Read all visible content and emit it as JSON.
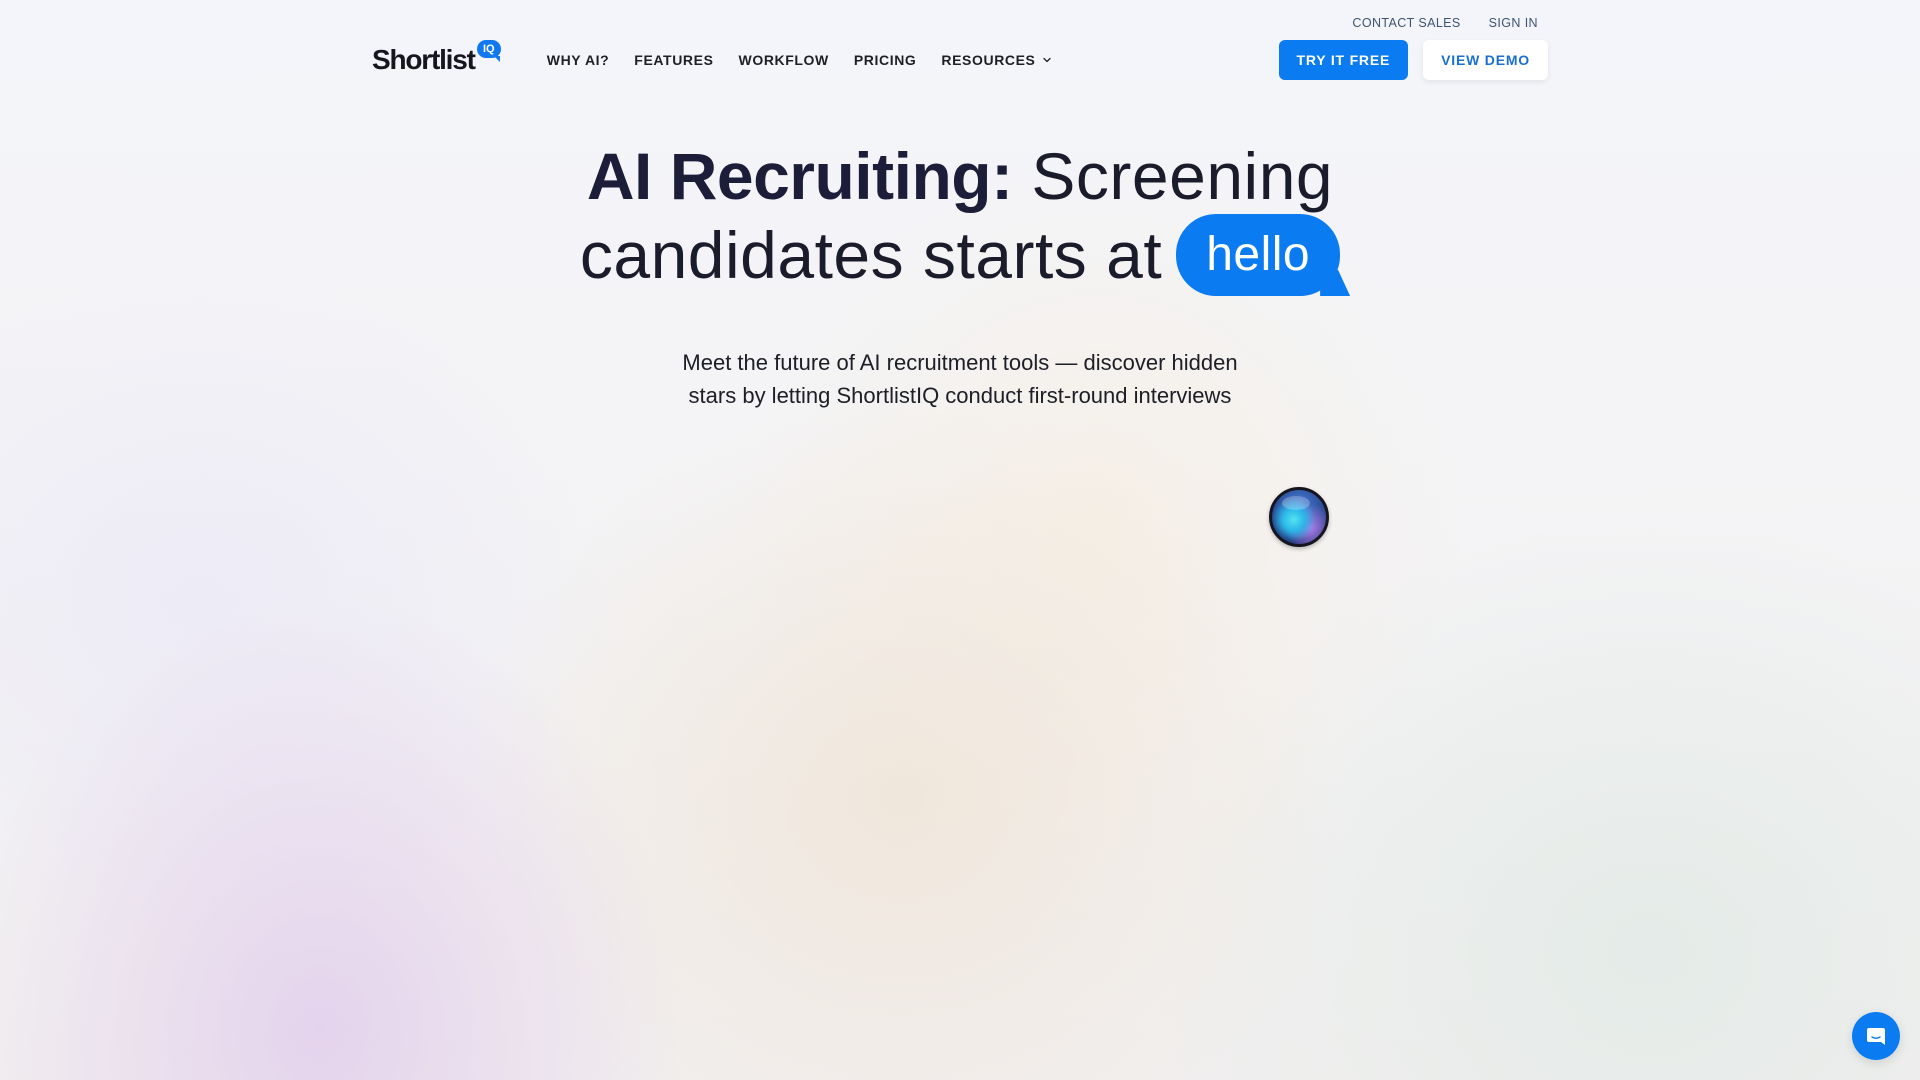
{
  "utility_links": {
    "contact_sales": "CONTACT SALES",
    "sign_in": "SIGN IN"
  },
  "header": {
    "logo_text": "Shortlist",
    "logo_badge": "IQ",
    "nav": [
      {
        "label": "WHY AI?"
      },
      {
        "label": "FEATURES"
      },
      {
        "label": "WORKFLOW"
      },
      {
        "label": "PRICING"
      },
      {
        "label": "RESOURCES",
        "icon": "chevron-down-icon"
      }
    ],
    "try_free_label": "TRY IT FREE",
    "view_demo_label": "VIEW DEMO"
  },
  "hero": {
    "title_bold": "AI Recruiting:",
    "title_rest": " Screening",
    "title_line2": "candidates starts at",
    "bubble_text": "hello",
    "subtitle_line1": "Meet the future of AI recruitment tools — discover hidden",
    "subtitle_line2": "stars by letting ShortlistIQ conduct first-round interviews"
  },
  "widgets": {
    "orb_icon": "ai-orb-icon",
    "chat_icon": "chat-launcher-icon"
  },
  "colors": {
    "brand_blue": "#0b7bf2",
    "heading_dark": "#1c1d38",
    "secondary_link": "#1a6fd1"
  }
}
